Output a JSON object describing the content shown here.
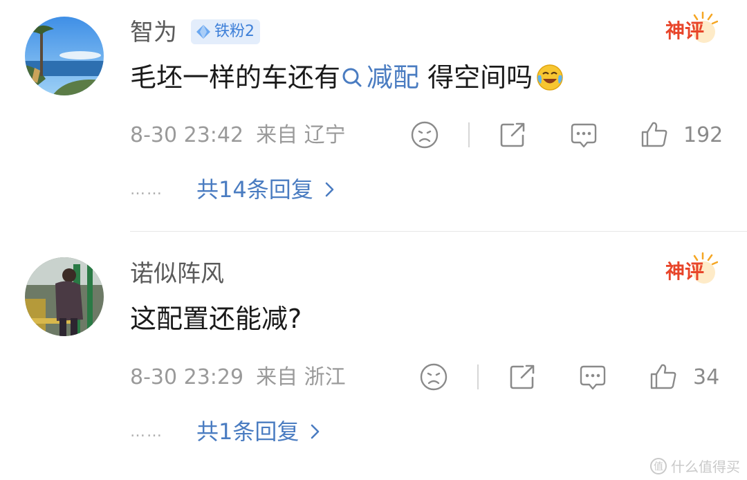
{
  "comments": [
    {
      "username": "智为",
      "fan_badge": "铁粉2",
      "shenping_label": "神评",
      "content_before": "毛坯一样的车还有",
      "topic": "减配",
      "content_after": " 得空间吗",
      "emoji": "laugh-cry-emoji",
      "time": "8-30 23:42",
      "location": "来自 辽宁",
      "likes": "192",
      "replies": "共14条回复",
      "dots": "……",
      "icons": [
        "dislike-face-icon",
        "share-icon",
        "comment-icon",
        "like-thumb-icon",
        "chevron-right-icon"
      ]
    },
    {
      "username": "诺似阵风",
      "shenping_label": "神评",
      "content": "这配置还能减?",
      "time": "8-30 23:29",
      "location": "来自 浙江",
      "likes": "34",
      "replies": "共1条回复",
      "dots": "……",
      "icons": [
        "dislike-face-icon",
        "share-icon",
        "comment-icon",
        "like-thumb-icon",
        "chevron-right-icon"
      ]
    }
  ],
  "watermark": "什么值得买",
  "colors": {
    "link_blue": "#4a7cc1",
    "badge_bg": "#e3edfb",
    "shenping_red": "#e8452a",
    "shenping_orange": "#f5a623",
    "meta_gray": "#9a9a9a"
  }
}
